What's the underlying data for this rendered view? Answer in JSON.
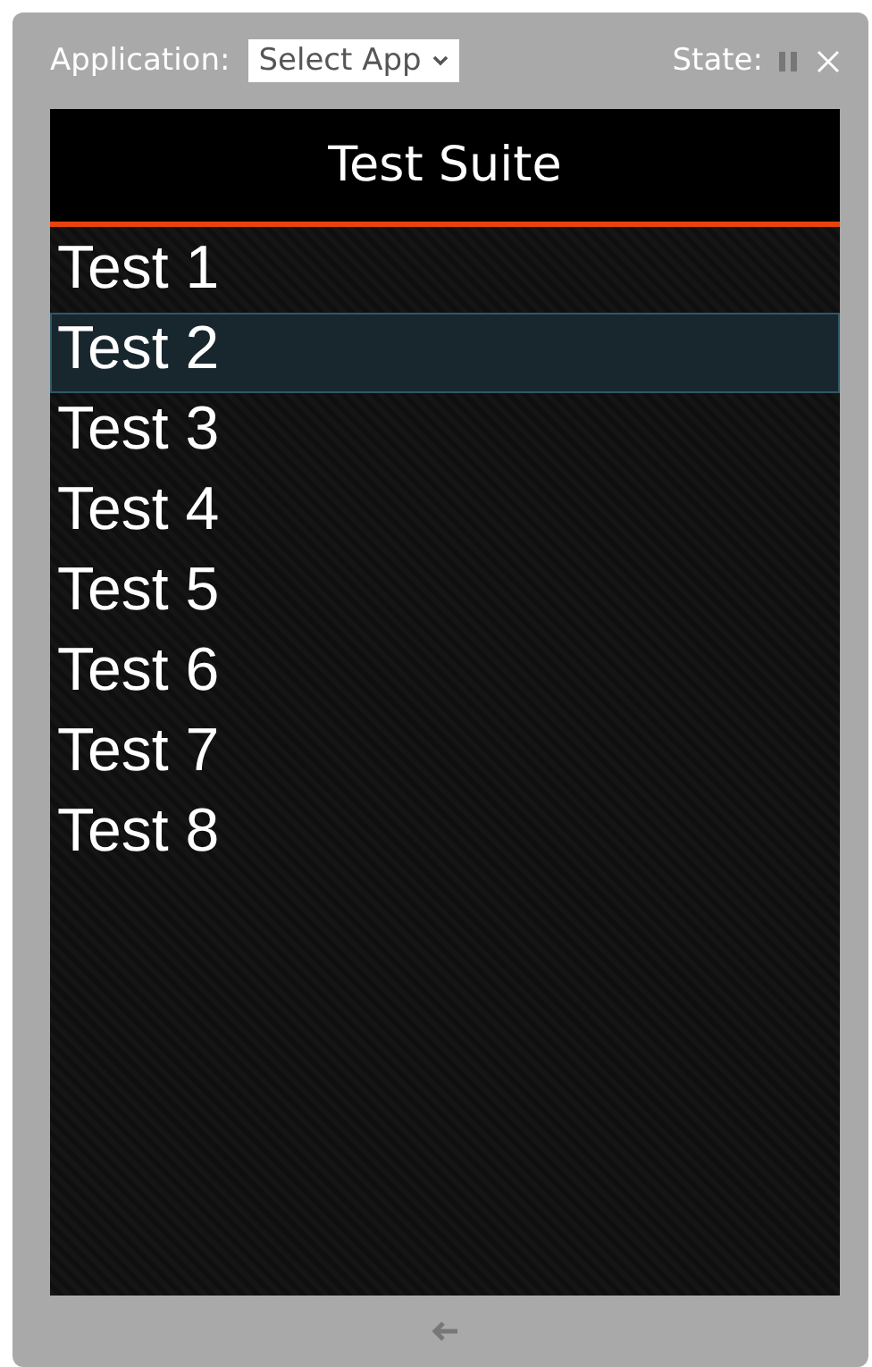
{
  "toolbar": {
    "application_label": "Application:",
    "application_select": "Select App",
    "state_label": "State:"
  },
  "suite": {
    "title": "Test Suite",
    "tests": [
      {
        "label": "Test 1",
        "selected": false
      },
      {
        "label": "Test 2",
        "selected": true
      },
      {
        "label": "Test 3",
        "selected": false
      },
      {
        "label": "Test 4",
        "selected": false
      },
      {
        "label": "Test 5",
        "selected": false
      },
      {
        "label": "Test 6",
        "selected": false
      },
      {
        "label": "Test 7",
        "selected": false
      },
      {
        "label": "Test 8",
        "selected": false
      }
    ]
  }
}
